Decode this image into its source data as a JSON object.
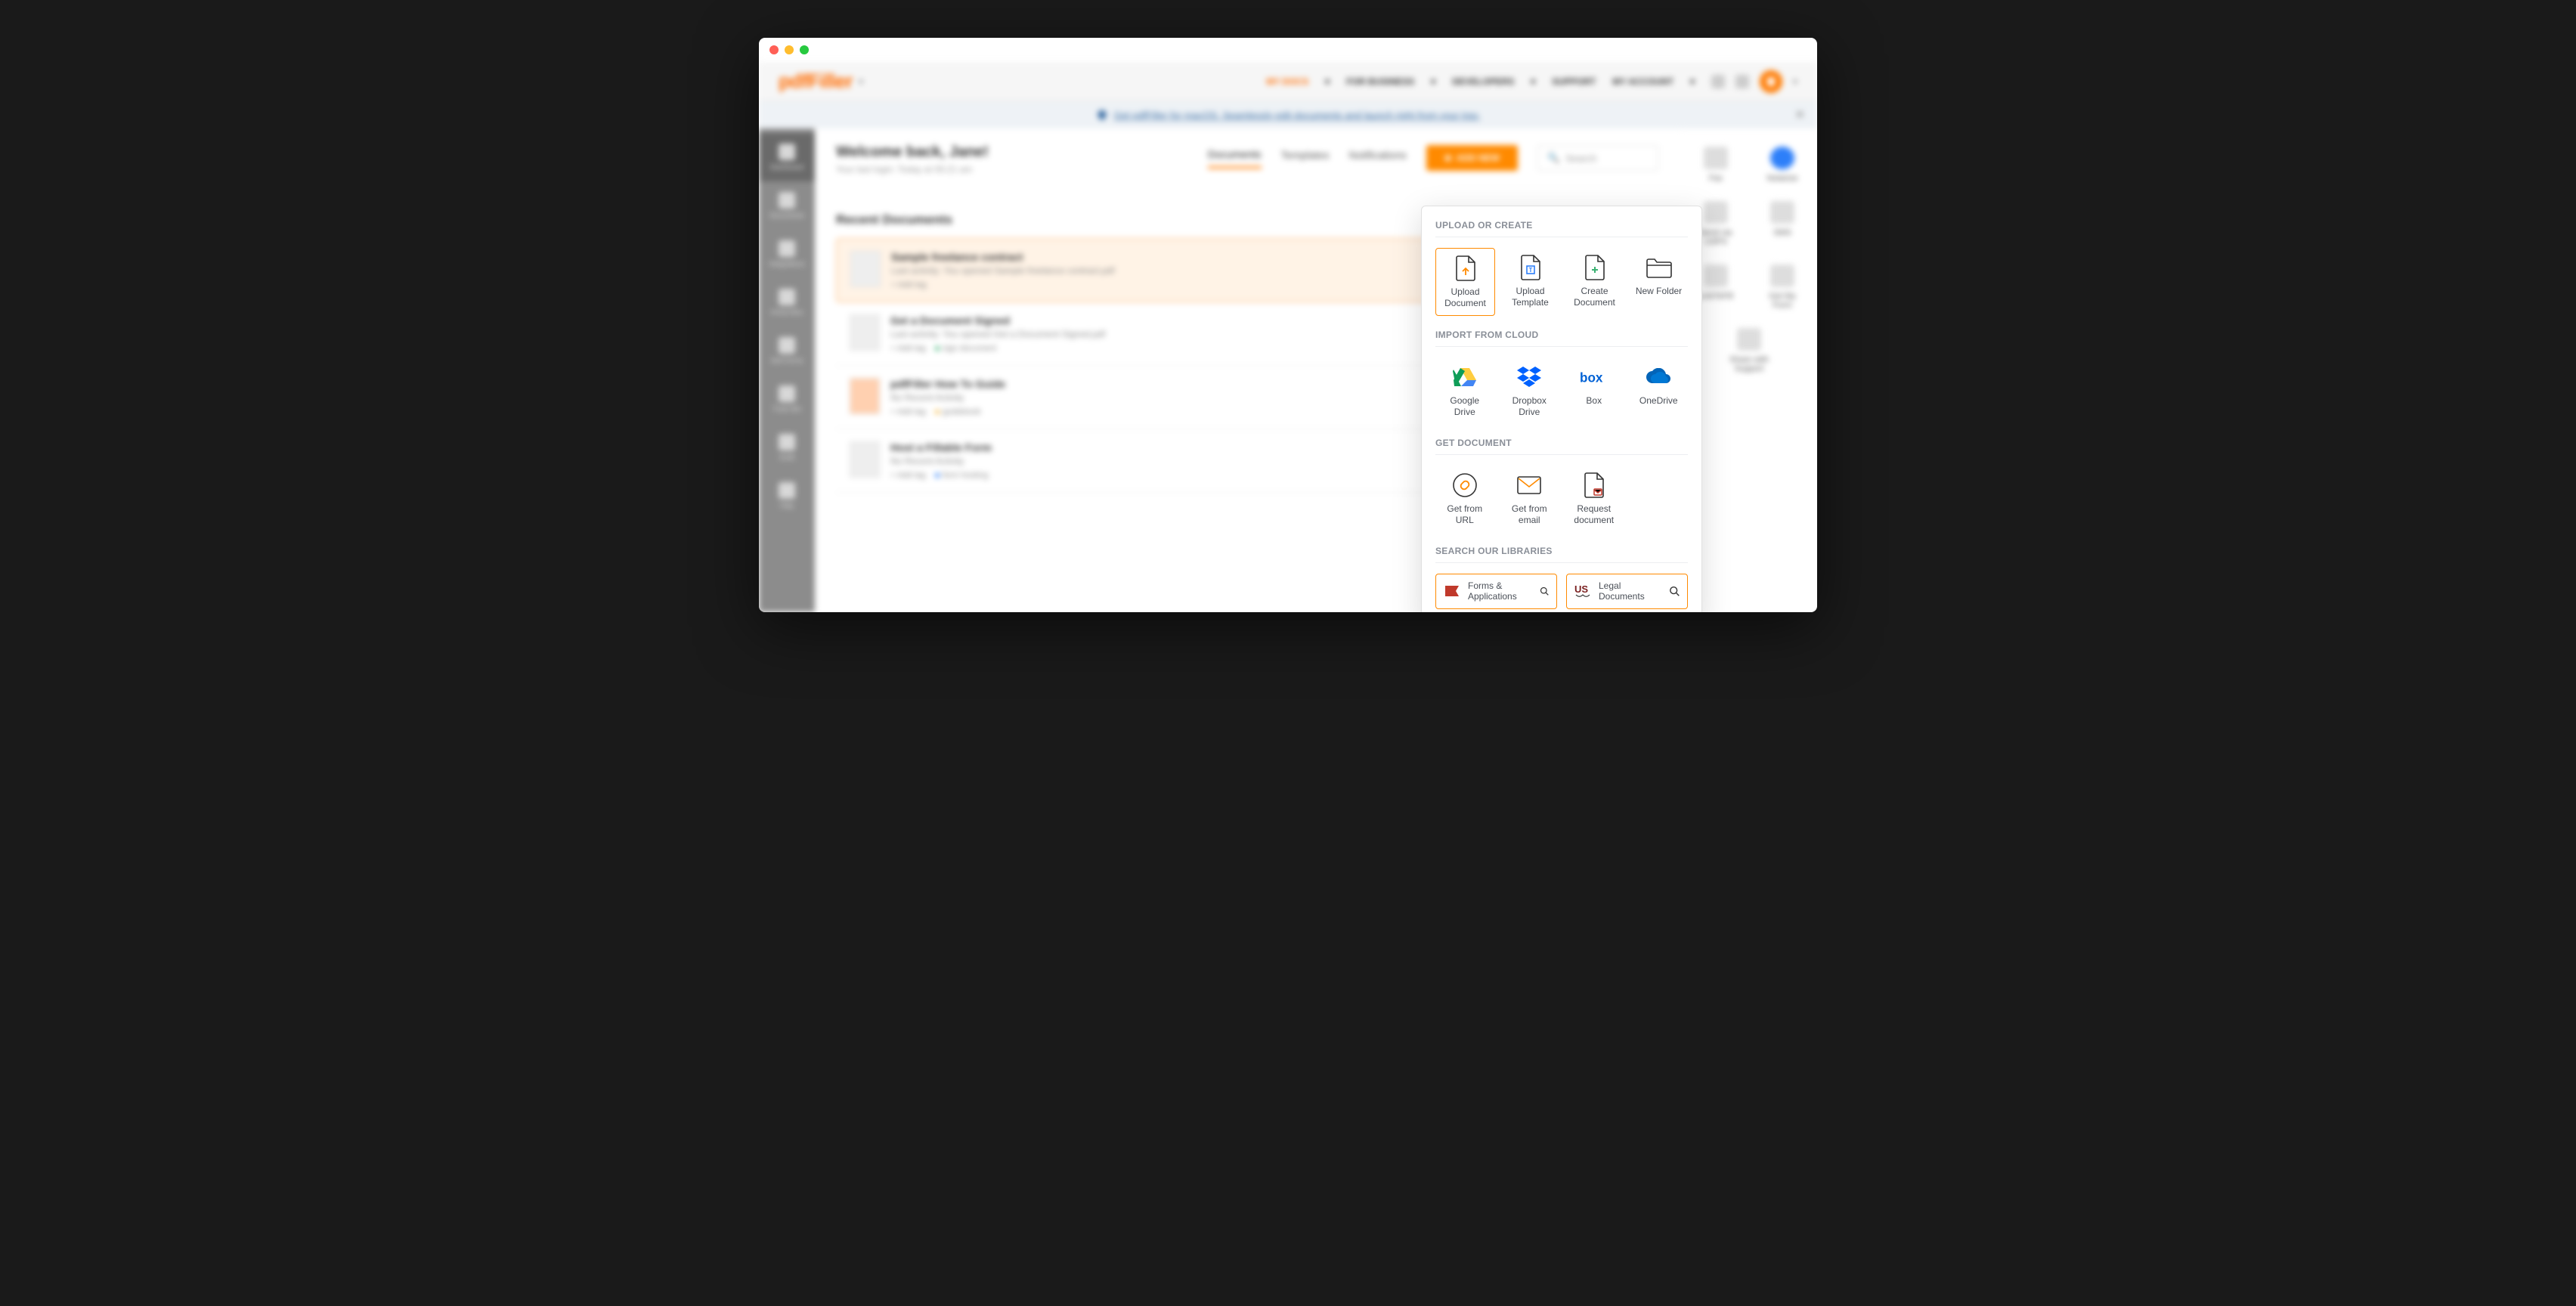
{
  "logo": "pdfFiller",
  "topnav": {
    "mydocs": "MY DOCS",
    "forbusiness": "FOR BUSINESS",
    "developers": "DEVELOPERS",
    "support": "SUPPORT",
    "myaccount": "MY ACCOUNT"
  },
  "banner": "Get pdfFiller for macOS. Seamlessly edit documents and launch right from your tray.",
  "sidebar": {
    "dashboard": "Dashboard",
    "documents": "Documents",
    "integrations": "Integrations",
    "inbox": "In/Out Box",
    "sellforms": "Sell Forms",
    "trash": "Trash Bin",
    "audit": "Audit",
    "help": "Help"
  },
  "welcome": "Welcome back, Jane!",
  "lastlogin": "Your last login: Today at 05:21 am",
  "tabs": {
    "documents": "Documents",
    "templates": "Templates",
    "notifications": "Notifications"
  },
  "addnew": "ADD NEW",
  "search_placeholder": "Search",
  "recent_heading": "Recent Documents",
  "docs": [
    {
      "title": "Sample freelance contract",
      "sub": "Last activity: You opened Sample freelance contract.pdf",
      "addtag": "+ Add tag"
    },
    {
      "title": "Get a Document Signed",
      "sub": "Last activity: You opened Get a Document Signed.pdf",
      "addtag": "+ Add tag",
      "tag2": "sign document"
    },
    {
      "title": "pdfFiller How To Guide",
      "sub": "No Recent Activity",
      "addtag": "+ Add tag",
      "tag2": "guidebook"
    },
    {
      "title": "Host a Fillable Form",
      "sub": "No Recent Activity",
      "addtag": "+ Add tag",
      "tag2": "form hosting"
    }
  ],
  "right_actions": {
    "fax": "Fax",
    "notarize": "Notarize",
    "sendusps": "Send via USPS",
    "sms": "SMS",
    "linktofill": "LinkToFill",
    "getmyform": "Get My Form",
    "sharesupport": "Share with Support"
  },
  "popover": {
    "s1": "UPLOAD OR CREATE",
    "upload_document": "Upload Document",
    "upload_template": "Upload Template",
    "create_document": "Create Document",
    "new_folder": "New Folder",
    "s2": "IMPORT FROM CLOUD",
    "gdrive": "Google Drive",
    "dropbox": "Dropbox Drive",
    "box": "Box",
    "onedrive": "OneDrive",
    "s3": "GET DOCUMENT",
    "from_url": "Get from URL",
    "from_email": "Get from email",
    "request": "Request document",
    "s4": "SEARCH OUR LIBRARIES",
    "forms_apps": "Forms & Applications",
    "legal": "Legal Documents"
  }
}
